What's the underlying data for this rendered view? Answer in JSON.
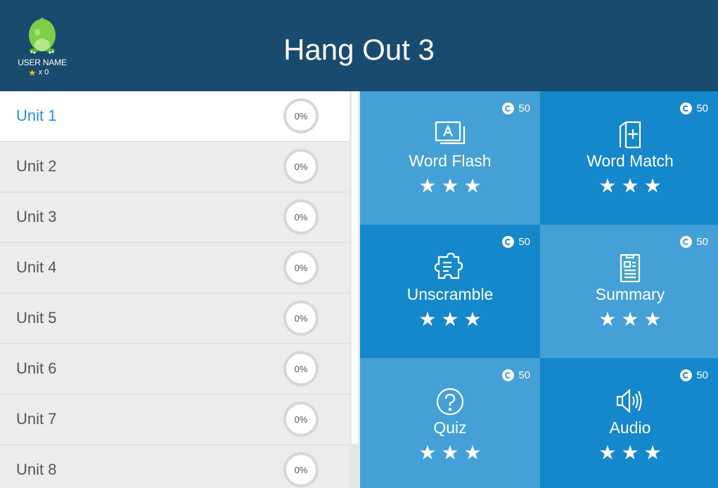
{
  "header": {
    "title": "Hang Out 3",
    "user_name": "USER NAME",
    "star_count": "x 0",
    "star_icon": "star-icon",
    "avatar": "green-egg-avatar"
  },
  "units": [
    {
      "label": "Unit 1",
      "progress": "0%",
      "active": true
    },
    {
      "label": "Unit 2",
      "progress": "0%"
    },
    {
      "label": "Unit 3",
      "progress": "0%"
    },
    {
      "label": "Unit 4",
      "progress": "0%"
    },
    {
      "label": "Unit 5",
      "progress": "0%"
    },
    {
      "label": "Unit 6",
      "progress": "0%"
    },
    {
      "label": "Unit 7",
      "progress": "0%"
    },
    {
      "label": "Unit 8",
      "progress": "0%"
    }
  ],
  "activities": [
    {
      "label": "Word Flash",
      "coins": "50",
      "icon": "flashcard-icon",
      "stars": 3
    },
    {
      "label": "Word Match",
      "coins": "50",
      "icon": "card-match-icon",
      "stars": 3
    },
    {
      "label": "Unscramble",
      "coins": "50",
      "icon": "puzzle-icon",
      "stars": 3
    },
    {
      "label": "Summary",
      "coins": "50",
      "icon": "document-icon",
      "stars": 3
    },
    {
      "label": "Quiz",
      "coins": "50",
      "icon": "question-icon",
      "stars": 3
    },
    {
      "label": "Audio",
      "coins": "50",
      "icon": "speaker-icon",
      "stars": 3
    }
  ],
  "colors": {
    "header_bg": "#194b6e",
    "tile_light": "#44a0d6",
    "tile_dark": "#1587cb",
    "active_unit_text": "#2a8fd0",
    "star_gold": "#f5b820"
  }
}
